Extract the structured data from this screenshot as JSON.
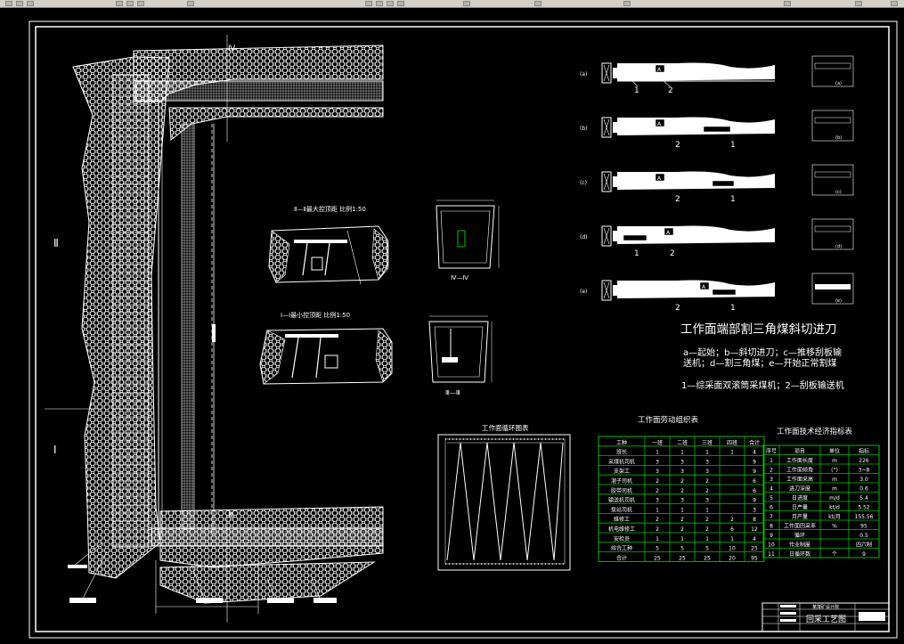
{
  "cutting": {
    "title": "工作面端部割三角煤斜切进刀",
    "legend_line1": "a—起始；b—斜切进刀；c—推移刮板输",
    "legend_line2": "送机；d—割三角煤；e—开始正常割煤",
    "legend_line3": "1—综采面双滚筒采煤机；2—刮板输送机",
    "steps": [
      {
        "label": "(a)",
        "side": "(a)",
        "n1": "1",
        "n2": "2"
      },
      {
        "label": "(b)",
        "side": "(b)",
        "n1": "2",
        "n2": "1"
      },
      {
        "label": "(c)",
        "side": "(c)",
        "n1": "2",
        "n2": "1"
      },
      {
        "label": "(d)",
        "side": "(d)",
        "n1": "1",
        "n2": "2"
      },
      {
        "label": "(e)",
        "side": "(e)",
        "n1": "2",
        "n2": "1"
      }
    ],
    "marker": "A"
  },
  "sections": {
    "s22_title": "Ⅱ—Ⅱ最大控顶距    比例1:50",
    "s11_title": "Ⅰ—Ⅰ最小控顶距    比例1:50",
    "s44_label": "Ⅳ—Ⅳ",
    "s33_label": "Ⅲ—Ⅲ"
  },
  "plan": {
    "mark_II_left": "Ⅱ",
    "mark_I_left": "Ⅰ",
    "mark_IV": "Ⅳ",
    "mark_III": "Ⅲ"
  },
  "cycle": {
    "title": "工作面循环图表"
  },
  "labor": {
    "title": "工作面劳动组织表",
    "headers": [
      "工种",
      "一班",
      "二班",
      "三班",
      "四班",
      "合计"
    ],
    "rows": [
      [
        "班长",
        "1",
        "1",
        "1",
        "1",
        "4"
      ],
      [
        "采煤机司机",
        "3",
        "3",
        "3",
        "",
        "9"
      ],
      [
        "支架工",
        "3",
        "3",
        "3",
        "",
        "9"
      ],
      [
        "溜子司机",
        "2",
        "2",
        "2",
        "",
        "6"
      ],
      [
        "胶带司机",
        "2",
        "2",
        "2",
        "",
        "6"
      ],
      [
        "输送机司机",
        "3",
        "3",
        "3",
        "",
        "9"
      ],
      [
        "泵站司机",
        "1",
        "1",
        "1",
        "",
        "3"
      ],
      [
        "维修工",
        "2",
        "2",
        "2",
        "2",
        "8"
      ],
      [
        "机电维修工",
        "2",
        "2",
        "2",
        "6",
        "12"
      ],
      [
        "安检员",
        "1",
        "1",
        "1",
        "1",
        "4"
      ],
      [
        "综合工种",
        "5",
        "5",
        "5",
        "10",
        "25"
      ],
      [
        "合计",
        "25",
        "25",
        "25",
        "20",
        "95"
      ]
    ]
  },
  "tech": {
    "title": "工作面技术经济指标表",
    "headers": [
      "序号",
      "项目",
      "单位",
      "指标"
    ],
    "rows": [
      [
        "1",
        "工作面长度",
        "m",
        "226"
      ],
      [
        "2",
        "工作面倾角",
        "(°)",
        "3~8"
      ],
      [
        "3",
        "工作面采高",
        "m",
        "3.0"
      ],
      [
        "4",
        "进刀深度",
        "m",
        "0.6"
      ],
      [
        "5",
        "日进度",
        "m/d",
        "5.4"
      ],
      [
        "6",
        "日产量",
        "kt/d",
        "5.52"
      ],
      [
        "7",
        "月产量",
        "kt/月",
        "155.56"
      ],
      [
        "8",
        "工作面回采率",
        "%",
        "95"
      ],
      [
        "9",
        "循环",
        "",
        "0.5"
      ],
      [
        "10",
        "作业制度",
        "",
        "四六制"
      ],
      [
        "11",
        "日循环数",
        "个",
        "9"
      ]
    ]
  },
  "titleblock": {
    "company": "某煤矿设计院",
    "drawing": "回采工艺图"
  },
  "colors": {
    "background": "#000000",
    "lines": "#ffffff",
    "table_green": "#00c000"
  }
}
